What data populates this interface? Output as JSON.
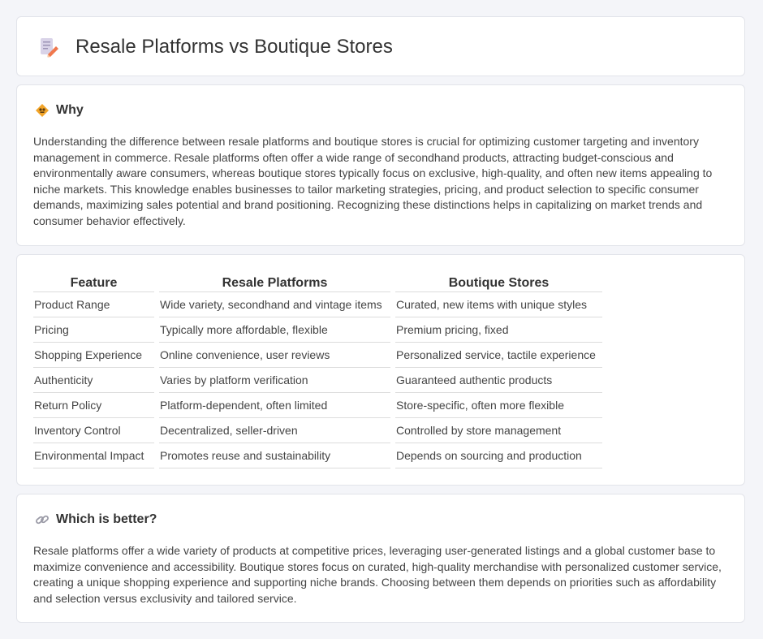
{
  "header": {
    "title": "Resale Platforms vs Boutique Stores",
    "icon": "document-pencil-icon"
  },
  "why": {
    "title": "Why",
    "icon": "diamond-sign-icon",
    "text": "Understanding the difference between resale platforms and boutique stores is crucial for optimizing customer targeting and inventory management in commerce. Resale platforms often offer a wide range of secondhand products, attracting budget-conscious and environmentally aware consumers, whereas boutique stores typically focus on exclusive, high-quality, and often new items appealing to niche markets. This knowledge enables businesses to tailor marketing strategies, pricing, and product selection to specific consumer demands, maximizing sales potential and brand positioning. Recognizing these distinctions helps in capitalizing on market trends and consumer behavior effectively."
  },
  "table": {
    "headers": [
      "Feature",
      "Resale Platforms",
      "Boutique Stores"
    ],
    "rows": [
      [
        "Product Range",
        "Wide variety, secondhand and vintage items",
        "Curated, new items with unique styles"
      ],
      [
        "Pricing",
        "Typically more affordable, flexible",
        "Premium pricing, fixed"
      ],
      [
        "Shopping Experience",
        "Online convenience, user reviews",
        "Personalized service, tactile experience"
      ],
      [
        "Authenticity",
        "Varies by platform verification",
        "Guaranteed authentic products"
      ],
      [
        "Return Policy",
        "Platform-dependent, often limited",
        "Store-specific, often more flexible"
      ],
      [
        "Inventory Control",
        "Decentralized, seller-driven",
        "Controlled by store management"
      ],
      [
        "Environmental Impact",
        "Promotes reuse and sustainability",
        "Depends on sourcing and production"
      ]
    ]
  },
  "better": {
    "title": "Which is better?",
    "icon": "link-icon",
    "text": "Resale platforms offer a wide variety of products at competitive prices, leveraging user-generated listings and a global customer base to maximize convenience and accessibility. Boutique stores focus on curated, high-quality merchandise with personalized customer service, creating a unique shopping experience and supporting niche brands. Choosing between them depends on priorities such as affordability and selection versus exclusivity and tailored service."
  }
}
